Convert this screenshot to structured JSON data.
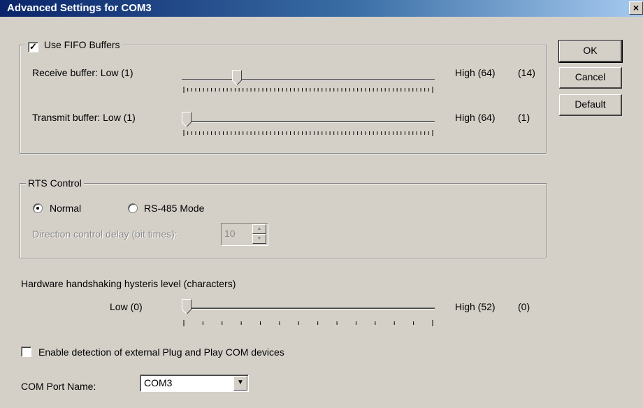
{
  "window": {
    "title": "Advanced Settings for COM3",
    "close_glyph": "×"
  },
  "buttons": {
    "ok": "OK",
    "cancel": "Cancel",
    "default": "Default"
  },
  "fifo": {
    "checkbox_label": "Use FIFO Buffers",
    "checked": true,
    "receive": {
      "label": "Receive buffer: Low (1)",
      "high_label": "High (64)",
      "value_label": "(14)",
      "value": 14,
      "min": 1,
      "max": 64
    },
    "transmit": {
      "label": "Transmit buffer: Low (1)",
      "high_label": "High (64)",
      "value_label": "(1)",
      "value": 1,
      "min": 1,
      "max": 64
    }
  },
  "rts": {
    "title": "RTS Control",
    "normal_label": "Normal",
    "rs485_label": "RS-485 Mode",
    "selected": "Normal",
    "delay_label": "Direction control delay (bit times):",
    "delay_value": "10"
  },
  "hysteresis": {
    "title": "Hardware handshaking hysteris level (characters)",
    "low_label": "Low (0)",
    "high_label": "High (52)",
    "value_label": "(0)",
    "value": 0,
    "min": 0,
    "max": 52
  },
  "plugplay": {
    "label": "Enable detection of external Plug and Play COM devices",
    "checked": false
  },
  "com_port": {
    "label": "COM Port Name:",
    "value": "COM3"
  },
  "icons": {
    "check": "check-icon",
    "dropdown": "chevron-down-icon",
    "spin_up": "spin-up-icon",
    "spin_down": "spin-down-icon",
    "close": "close-icon"
  },
  "colors": {
    "title_start": "#0a246a",
    "title_end": "#a6caf0",
    "face": "#d4d0c8"
  }
}
